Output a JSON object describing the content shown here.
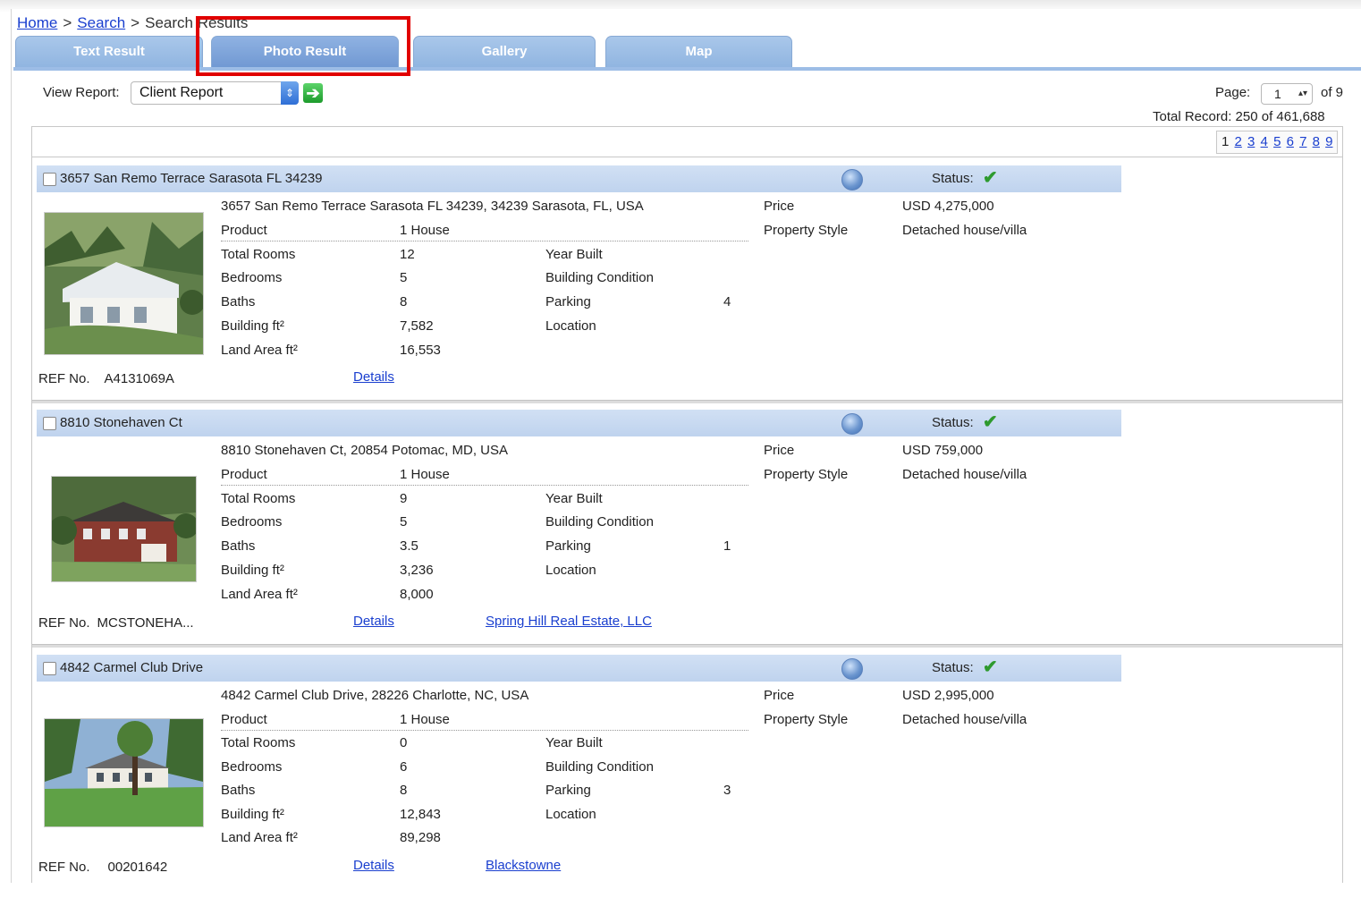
{
  "breadcrumb": {
    "home": "Home",
    "search": "Search",
    "current": "Search Results",
    "separator": ">"
  },
  "tabs": [
    {
      "label": "Text Result"
    },
    {
      "label": "Photo Result"
    },
    {
      "label": "Gallery"
    },
    {
      "label": "Map"
    }
  ],
  "controls": {
    "view_report_label": "View Report:",
    "view_report_value": "Client Report",
    "page_label": "Page:",
    "page_value": "1",
    "page_of": "of 9",
    "total_record": "Total Record: 250 of 461,688"
  },
  "pagination": {
    "current": "1",
    "pages": [
      "2",
      "3",
      "4",
      "5",
      "6",
      "7",
      "8",
      "9"
    ]
  },
  "field_labels": {
    "price": "Price",
    "property_style": "Property Style",
    "product": "Product",
    "total_rooms": "Total Rooms",
    "bedrooms": "Bedrooms",
    "baths": "Baths",
    "building": "Building ft²",
    "land": "Land Area ft²",
    "year_built": "Year Built",
    "building_condition": "Building Condition",
    "parking": "Parking",
    "location": "Location",
    "ref_no": "REF No.",
    "details": "Details",
    "status": "Status:"
  },
  "colors": {
    "tab_blue": "#8fb4e0",
    "header_blue": "#c9dbf2",
    "link": "#1a3fcf",
    "highlight_red": "#e10000",
    "status_green": "#2e9a2e"
  },
  "listings": [
    {
      "title": "3657 San Remo Terrace Sarasota FL 34239",
      "address": "3657 San Remo Terrace Sarasota FL 34239, 34239 Sarasota, FL, USA",
      "price": "USD 4,275,000",
      "property_style": "Detached house/villa",
      "product": "1 House",
      "total_rooms": "12",
      "bedrooms": "5",
      "baths": "8",
      "building": "7,582",
      "land": "16,553",
      "parking": "4",
      "ref": "A4131069A",
      "agent": ""
    },
    {
      "title": "8810 Stonehaven Ct",
      "address": "8810 Stonehaven Ct, 20854 Potomac, MD, USA",
      "price": "USD 759,000",
      "property_style": "Detached house/villa",
      "product": "1 House",
      "total_rooms": "9",
      "bedrooms": "5",
      "baths": "3.5",
      "building": "3,236",
      "land": "8,000",
      "parking": "1",
      "ref": "MCSTONEHA...",
      "agent": "Spring Hill Real Estate, LLC"
    },
    {
      "title": "4842 Carmel Club Drive",
      "address": "4842 Carmel Club Drive, 28226 Charlotte, NC, USA",
      "price": "USD 2,995,000",
      "property_style": "Detached house/villa",
      "product": "1 House",
      "total_rooms": "0",
      "bedrooms": "6",
      "baths": "8",
      "building": "12,843",
      "land": "89,298",
      "parking": "3",
      "ref": "00201642",
      "agent": "Blackstowne"
    }
  ]
}
